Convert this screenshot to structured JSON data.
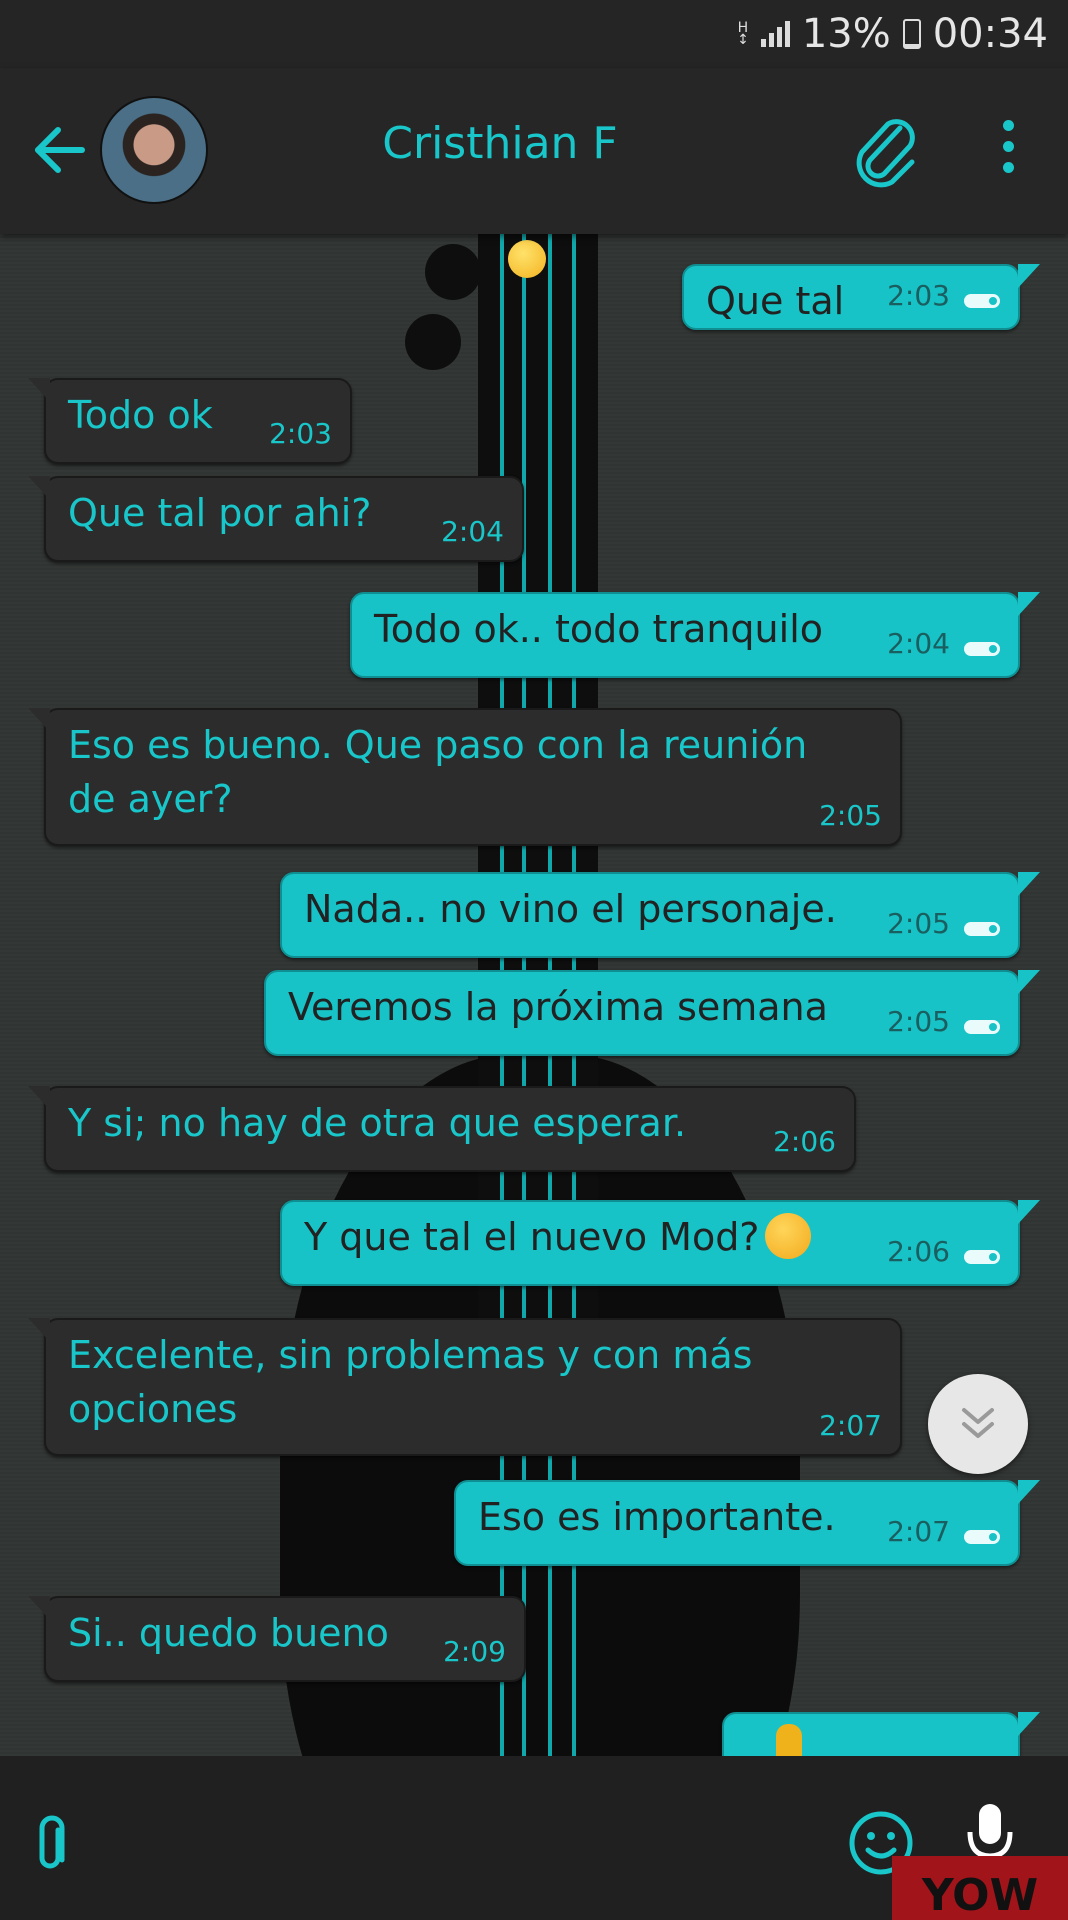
{
  "status_bar": {
    "network": "H",
    "battery": "13%",
    "battery_level": 0.13,
    "time": "00:34"
  },
  "header": {
    "contact_name": "Cristhian F"
  },
  "messages": [
    {
      "dir": "out",
      "text": "Que tal",
      "time": "2:03"
    },
    {
      "dir": "in",
      "text": "Todo ok",
      "time": "2:03"
    },
    {
      "dir": "in",
      "text": "Que tal por ahi?",
      "time": "2:04"
    },
    {
      "dir": "out",
      "text": "Todo ok.. todo tranquilo",
      "time": "2:04"
    },
    {
      "dir": "in",
      "text": "Eso es bueno. Que paso con la reunión",
      "text2": "de ayer?",
      "time": "2:05"
    },
    {
      "dir": "out",
      "text": "Nada.. no vino el personaje.",
      "time": "2:05"
    },
    {
      "dir": "out",
      "text": "Veremos la próxima semana",
      "time": "2:05"
    },
    {
      "dir": "in",
      "text": "Y si; no hay de otra que esperar.",
      "time": "2:06"
    },
    {
      "dir": "out",
      "text": "Y que tal el nuevo Mod?",
      "emoji": "thinking-face",
      "time": "2:06"
    },
    {
      "dir": "in",
      "text": "Excelente, sin problemas y con más",
      "text2": "opciones",
      "time": "2:07"
    },
    {
      "dir": "out",
      "text": "Eso es importante.",
      "time": "2:07"
    },
    {
      "dir": "in",
      "text": "Si.. quedo bueno",
      "time": "2:09"
    }
  ],
  "watermark": "YOW",
  "colors": {
    "accent": "#19c6c9",
    "outgoing_bubble": "#17c3c6",
    "incoming_bubble": "#2c2c2c",
    "toolbar": "#262626"
  },
  "icons": [
    "back-arrow-icon",
    "paperclip-icon",
    "more-vert-icon",
    "chevron-double-down-icon",
    "emoji-icon",
    "microphone-icon"
  ]
}
